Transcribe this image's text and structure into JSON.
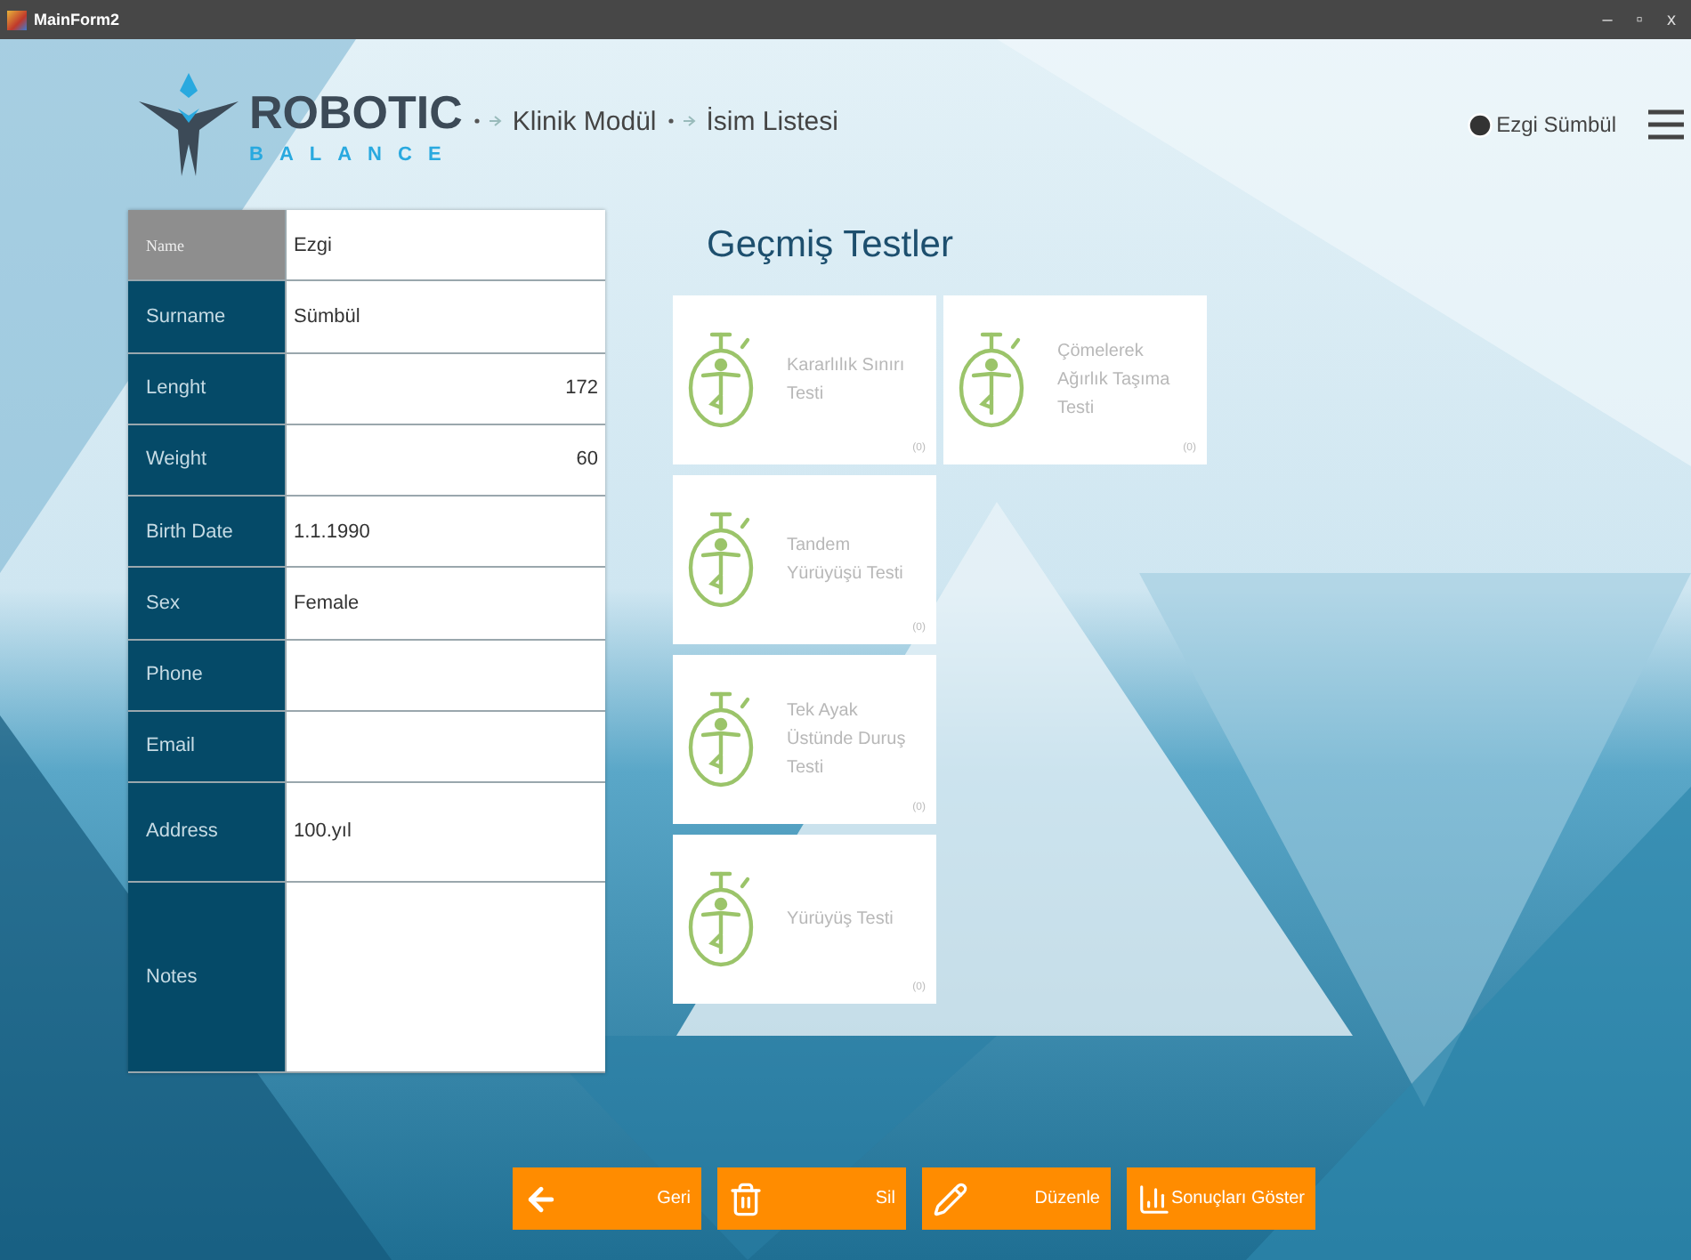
{
  "window": {
    "title": "MainForm2",
    "controls": [
      "–",
      "▫",
      "x"
    ]
  },
  "header": {
    "logo": {
      "word": "ROBOTIC",
      "subword": "BALANCE"
    },
    "breadcrumb": [
      {
        "label": "Klinik Modül"
      },
      {
        "label": "İsim Listesi"
      }
    ],
    "user": "Ezgi Sümbül"
  },
  "form": {
    "rows": [
      {
        "label": "Name",
        "value": "Ezgi",
        "kind": "text",
        "selected": true
      },
      {
        "label": "Surname",
        "value": "Sümbül",
        "kind": "text",
        "selected": false
      },
      {
        "label": "Lenght",
        "value": "172",
        "kind": "number",
        "selected": false
      },
      {
        "label": "Weight",
        "value": "60",
        "kind": "number",
        "selected": false
      },
      {
        "label": "Birth Date",
        "value": "1.1.1990",
        "kind": "text",
        "selected": false
      },
      {
        "label": "Sex",
        "value": "Female",
        "kind": "text",
        "selected": false
      },
      {
        "label": "Phone",
        "kind": "text",
        "selected": false
      },
      {
        "label": "Email",
        "kind": "text",
        "selected": false
      },
      {
        "label": "Address",
        "value": "100.yıl",
        "kind": "tall",
        "selected": false
      },
      {
        "label": "Notes",
        "kind": "notes",
        "selected": false
      }
    ]
  },
  "tests": {
    "title": "Geçmiş Testler",
    "cards": [
      {
        "name": "Kararlılık Sınırı Testi",
        "count": "(0)"
      },
      {
        "name": "Çömelerek Ağırlık Taşıma Testi",
        "count": "(0)"
      },
      {
        "name": "Tandem Yürüyüşü Testi",
        "count": "(0)"
      },
      {
        "name": "Tek Ayak Üstünde Duruş Testi",
        "count": "(0)"
      },
      {
        "name": "Yürüyüş Testi",
        "count": "(0)"
      }
    ]
  },
  "buttons": [
    {
      "label": "Geri",
      "kind": "back"
    },
    {
      "label": "Sil",
      "kind": "delete"
    },
    {
      "label": "Düzenle",
      "kind": "edit"
    },
    {
      "label": "Sonuçları Göster",
      "kind": "results"
    }
  ]
}
